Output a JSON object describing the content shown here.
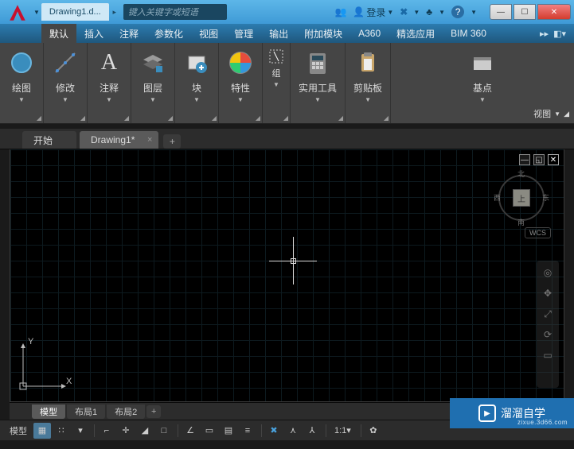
{
  "titlebar": {
    "filename": "Drawing1.d...",
    "search_placeholder": "键入关键字或短语",
    "login": "登录"
  },
  "menus": {
    "items": [
      "默认",
      "插入",
      "注释",
      "参数化",
      "视图",
      "管理",
      "输出",
      "附加模块",
      "A360",
      "精选应用",
      "BIM 360"
    ],
    "active_index": 0
  },
  "ribbon": {
    "groups": [
      {
        "label": "绘图"
      },
      {
        "label": "修改"
      },
      {
        "label": "注释"
      },
      {
        "label": "图层"
      },
      {
        "label": "块"
      },
      {
        "label": "特性"
      },
      {
        "label": "组"
      },
      {
        "label": "实用工具"
      },
      {
        "label": "剪贴板"
      },
      {
        "label": "基点"
      }
    ],
    "view_panel": "视图"
  },
  "doc_tabs": {
    "items": [
      "开始",
      "Drawing1*"
    ],
    "active_index": 1
  },
  "viewcube": {
    "top": "北",
    "bottom": "南",
    "left": "西",
    "right": "东",
    "face": "上",
    "wcs": "WCS"
  },
  "ucs": {
    "x": "X",
    "y": "Y"
  },
  "layout_tabs": {
    "items": [
      "模型",
      "布局1",
      "布局2"
    ],
    "active_index": 0
  },
  "status": {
    "model": "模型",
    "scale": "1:1"
  },
  "watermark": {
    "brand": "溜溜自学",
    "url": "zixue.3d66.com"
  }
}
